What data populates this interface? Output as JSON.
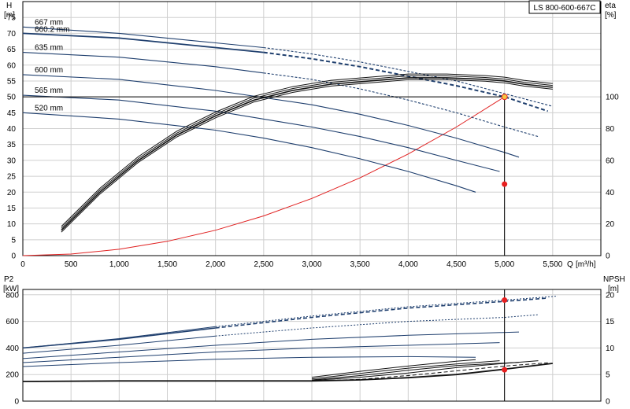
{
  "title": "LS 800-600-667C",
  "colors": {
    "curve": "#1f3f6e",
    "eff": "#111111",
    "system": "#e02020",
    "duty": "#e82020",
    "duty_fill": "#f5c542"
  },
  "chart_data": [
    {
      "type": "line",
      "panel": "head",
      "ylabel_left": "H",
      "yunit_left": "[m]",
      "ylabel_right": "eta",
      "yunit_right": "[%]",
      "xlabel": "Q",
      "xunit": "[m³/h]",
      "xlim": [
        0,
        6000
      ],
      "ylim": [
        0,
        80
      ],
      "ylim_right": [
        0,
        160
      ],
      "x_ticks": [
        "0",
        "500",
        "1,000",
        "1,500",
        "2,000",
        "2,500",
        "3,000",
        "3,500",
        "4,000",
        "4,500",
        "5,000",
        "5,500"
      ],
      "x_tick_values": [
        0,
        500,
        1000,
        1500,
        2000,
        2500,
        3000,
        3500,
        4000,
        4500,
        5000,
        5500
      ],
      "y_ticks": [
        0,
        5,
        10,
        15,
        20,
        25,
        30,
        35,
        40,
        45,
        50,
        55,
        60,
        65,
        70,
        75
      ],
      "y_ticks_right": [
        0,
        20,
        40,
        60,
        80,
        100
      ],
      "grid": true,
      "series": [
        {
          "label": "667 mm",
          "style": "thin",
          "x": [
            0,
            1000,
            2000,
            2500,
            3000,
            3500,
            4000,
            4500,
            5000,
            5500
          ],
          "y": [
            72,
            70,
            67,
            65.5,
            63.5,
            61,
            58,
            55,
            51,
            47
          ]
        },
        {
          "label": "660.2 mm",
          "style": "bold",
          "x": [
            0,
            1000,
            2000,
            2500,
            3000,
            3500,
            4000,
            4500,
            5000,
            5450
          ],
          "y": [
            70,
            68.5,
            65.5,
            64,
            62,
            59.5,
            56.5,
            53.5,
            50,
            45.5
          ]
        },
        {
          "label": "635 mm",
          "style": "thin",
          "x": [
            0,
            1000,
            2000,
            2500,
            3000,
            3500,
            4000,
            4500,
            5000,
            5350
          ],
          "y": [
            64,
            62.5,
            59.5,
            57.5,
            55.5,
            52.5,
            49,
            45,
            40.5,
            37.5
          ]
        },
        {
          "label": "600 mm",
          "style": "thin",
          "x": [
            0,
            1000,
            2000,
            3000,
            3500,
            4000,
            4500,
            5000,
            5150
          ],
          "y": [
            57,
            55.5,
            52,
            47.5,
            44.5,
            41,
            37,
            32.5,
            31
          ]
        },
        {
          "label": "565 mm",
          "style": "thin",
          "x": [
            0,
            1000,
            2000,
            3000,
            3500,
            4000,
            4500,
            4950
          ],
          "y": [
            50.5,
            49,
            45.5,
            40.5,
            37.5,
            34,
            30,
            26.5
          ]
        },
        {
          "label": "520 mm",
          "style": "thin",
          "x": [
            0,
            1000,
            2000,
            2500,
            3000,
            3500,
            4000,
            4500,
            4700
          ],
          "y": [
            45,
            43,
            39.5,
            37,
            34,
            30.5,
            26.5,
            22,
            20
          ]
        }
      ],
      "system_curve": {
        "x": [
          0,
          500,
          1000,
          1500,
          2000,
          2500,
          3000,
          3500,
          4000,
          4500,
          5000
        ],
        "y": [
          0,
          0.5,
          2,
          4.5,
          8,
          12.5,
          18,
          24.5,
          32,
          40.5,
          50
        ]
      },
      "efficiency": {
        "x": [
          400,
          800,
          1200,
          1600,
          2000,
          2400,
          2800,
          3200,
          3600,
          4000,
          4400,
          4800,
          5000,
          5200,
          5500
        ],
        "y": [
          8,
          20,
          30,
          38,
          44,
          49,
          52,
          54,
          55,
          56,
          56,
          55.5,
          55,
          54,
          53
        ]
      },
      "duty_point": {
        "x": 5000,
        "y": 50
      },
      "eff_point": {
        "x": 5000,
        "y": 22.5
      }
    },
    {
      "type": "line",
      "panel": "power",
      "ylabel_left": "P2",
      "yunit_left": "[kW]",
      "ylabel_right": "NPSH",
      "yunit_right": "[m]",
      "xlim": [
        0,
        6000
      ],
      "ylim": [
        0,
        840
      ],
      "ylim_right": [
        0,
        21
      ],
      "y_ticks": [
        0,
        200,
        400,
        600,
        800
      ],
      "y_ticks_right": [
        0,
        5,
        10,
        15,
        20
      ],
      "grid": true,
      "power_series": [
        {
          "x": [
            0,
            1000,
            2000,
            3000,
            4000,
            5000,
            5550
          ],
          "y": [
            400,
            470,
            560,
            640,
            710,
            760,
            790
          ]
        },
        {
          "x": [
            0,
            1000,
            2000,
            3000,
            4000,
            5000,
            5450
          ],
          "y": [
            400,
            465,
            550,
            630,
            700,
            750,
            775
          ]
        },
        {
          "x": [
            0,
            1000,
            2000,
            3000,
            4000,
            5000,
            5350
          ],
          "y": [
            360,
            420,
            490,
            550,
            600,
            630,
            650
          ]
        },
        {
          "x": [
            0,
            1000,
            2000,
            3000,
            4000,
            5150
          ],
          "y": [
            320,
            370,
            420,
            465,
            495,
            520
          ]
        },
        {
          "x": [
            0,
            1000,
            2000,
            3000,
            4000,
            4950
          ],
          "y": [
            290,
            330,
            370,
            400,
            420,
            440
          ]
        },
        {
          "x": [
            0,
            1000,
            2000,
            3000,
            4000,
            4700
          ],
          "y": [
            260,
            290,
            315,
            330,
            335,
            330
          ]
        }
      ],
      "npsh_series": [
        {
          "x": [
            0,
            1000,
            2000,
            3000,
            3500,
            4000,
            4500,
            5000,
            5500
          ],
          "y": [
            3.7,
            3.8,
            3.8,
            3.8,
            4.0,
            4.4,
            5.0,
            6.0,
            7.1
          ]
        },
        {
          "x": [
            3000,
            3500,
            4000,
            4500,
            5000,
            5450
          ],
          "y": [
            3.8,
            4.1,
            4.8,
            5.7,
            6.6,
            7.2
          ]
        },
        {
          "x": [
            3000,
            3500,
            4000,
            4500,
            5000,
            5350
          ],
          "y": [
            3.9,
            4.5,
            5.3,
            6.3,
            7.1,
            7.6
          ]
        },
        {
          "x": [
            3000,
            3500,
            4000,
            4500,
            5150
          ],
          "y": [
            4.0,
            4.8,
            5.8,
            6.7,
            7.3
          ]
        },
        {
          "x": [
            3000,
            3500,
            4000,
            4500,
            4950
          ],
          "y": [
            4.2,
            5.2,
            6.2,
            7.0,
            7.6
          ]
        },
        {
          "x": [
            3000,
            3500,
            4000,
            4500,
            4700
          ],
          "y": [
            4.5,
            5.6,
            6.6,
            7.5,
            7.8
          ]
        }
      ],
      "power_point": {
        "x": 5000,
        "y": 760
      },
      "npsh_point": {
        "x": 5000,
        "y": 5.9
      }
    }
  ]
}
